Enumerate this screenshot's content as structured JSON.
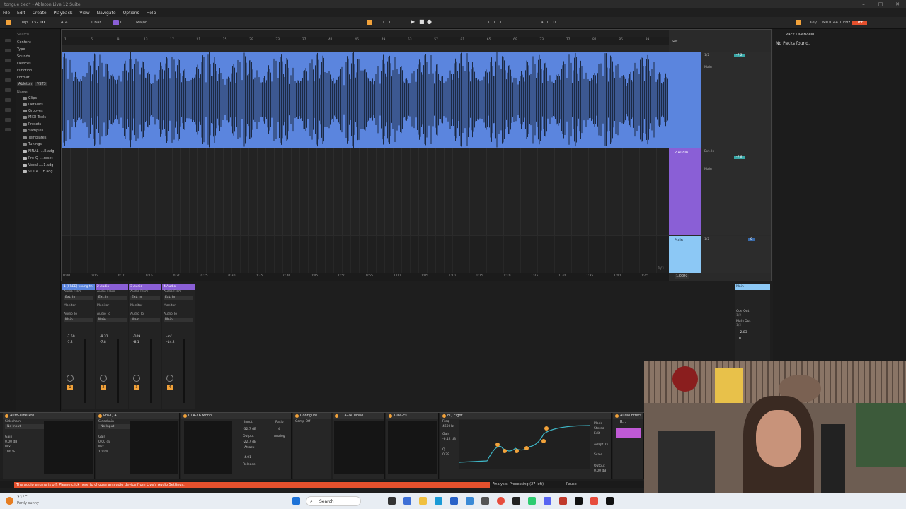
{
  "window": {
    "title": "tongue tied* - Ableton Live 12 Suite"
  },
  "menu": [
    "File",
    "Edit",
    "Create",
    "Playback",
    "View",
    "Navigate",
    "Options",
    "Help"
  ],
  "transport": {
    "tap": "Tap",
    "tempo": "132.00",
    "sig_num": "4",
    "sig_den": "4",
    "quantize": "1 Bar",
    "key": "C",
    "scale": "Major",
    "position": "1 . 1 . 1",
    "loop_start": "3 . 1 . 1",
    "loop_len": "4 . 0 . 0",
    "key_label": "Key",
    "midi_label": "MIDI",
    "sample_rate": "44.1 kHz",
    "cpu": "OFF"
  },
  "browser": {
    "search_placeholder": "Search",
    "filters": [
      "Content",
      "Type",
      "Sounds",
      "Devices",
      "Function",
      "Format"
    ],
    "tags": [
      "Ableton",
      "VST3"
    ],
    "name_header": "Name",
    "items": [
      "Clips",
      "Defaults",
      "Grooves",
      "MIDI Tools",
      "Presets",
      "Samples",
      "Templates",
      "Tunings",
      "FINAL ....E.adg",
      "Pro-Q ....reset",
      "Vocal ....1.adg",
      "VOCA....E.adg"
    ]
  },
  "arrangement": {
    "bars": [
      "1",
      "5",
      "9",
      "13",
      "17",
      "21",
      "25",
      "29",
      "33",
      "37",
      "41",
      "45",
      "49",
      "53",
      "57",
      "61",
      "65",
      "69",
      "73",
      "77",
      "81",
      "85",
      "89"
    ],
    "time": [
      "0:00",
      "0:05",
      "0:10",
      "0:15",
      "0:20",
      "0:25",
      "0:30",
      "0:35",
      "0:40",
      "0:45",
      "0:50",
      "0:55",
      "1:00",
      "1:05",
      "1:10",
      "1:15",
      "1:20",
      "1:25",
      "1:30",
      "1:35",
      "1:40",
      "1:45"
    ],
    "page": "1/1",
    "zoom": "1.00%",
    "set_label": "Set",
    "tracks": [
      {
        "name": "1 Audio",
        "color": "#5b85de",
        "in": "1/2",
        "vol": "-7.2",
        "route": "Main"
      },
      {
        "name": "2 Audio",
        "color": "#8a5fd6",
        "in": "Ext. In",
        "vol": "-7.8",
        "route": "Main"
      },
      {
        "name": "Main",
        "color": "#8cc8f5",
        "in": "1/2",
        "vol": "0",
        "route": ""
      }
    ]
  },
  "mixer": {
    "strips": [
      {
        "name": "1 [FREE] young th",
        "color": "#5b85de",
        "audio_from": "Audio From",
        "from": "Ext. In",
        "monitor": "Monitor",
        "audio_to": "Audio To",
        "to": "Main",
        "vol": "-7.50",
        "pan": "-7.2",
        "num": "1"
      },
      {
        "name": "2 Audio",
        "color": "#8a5fd6",
        "audio_from": "Audio From",
        "from": "Ext. In",
        "monitor": "Monitor",
        "audio_to": "Audio To",
        "to": "Main",
        "vol": "-9.31",
        "pan": "-7.8",
        "num": "2"
      },
      {
        "name": "3 Audio",
        "color": "#8a5fd6",
        "audio_from": "Audio From",
        "from": "Ext. In",
        "monitor": "Monitor",
        "audio_to": "Audio To",
        "to": "Main",
        "vol": "-109",
        "pan": "-8.1",
        "num": "3"
      },
      {
        "name": "4 Audio",
        "color": "#8a5fd6",
        "audio_from": "Audio From",
        "from": "Ext. In",
        "monitor": "Monitor",
        "audio_to": "Audio To",
        "to": "Main",
        "vol": "-inf",
        "pan": "-14.2",
        "num": "4"
      }
    ],
    "main": {
      "name": "Main",
      "cue_out": "Cue Out",
      "cue_val": "1/2",
      "main_out": "Main Out",
      "main_val": "1/2",
      "vol": "-2.83",
      "pan": "0"
    }
  },
  "devices": [
    {
      "name": "Auto-Tune Pro",
      "sidechain": "Sidechain",
      "input": "No Input",
      "gain": "Gain",
      "gain_val": "0.00 dB",
      "mix": "Mix",
      "mix_val": "100 %"
    },
    {
      "name": "Pro-Q 4",
      "sidechain": "Sidechain",
      "input": "No Input",
      "gain": "Gain",
      "gain_val": "0.00 dB",
      "mix": "Mix",
      "mix_val": "100 %"
    },
    {
      "name": "CLA-76 Mono"
    },
    {
      "name": "Configure",
      "input": "Input",
      "input_val": "-32.7 dB",
      "ratio": "Ratio",
      "ratio_val": "4",
      "output": "Output",
      "output_val": "-22.7 dB",
      "attack": "Attack",
      "attack_val": "Analog",
      "release": "Release",
      "release_val": "4.01",
      "comp": "Comp Off",
      "gain": "Gain"
    },
    {
      "name": "CLA-2A Mono"
    },
    {
      "name": "T-De-Es..."
    },
    {
      "name": "EQ Eight",
      "freq": "Freq",
      "freq_val": "460 Hz",
      "gain": "Gain",
      "gain_val": "-6.12 dB",
      "q": "Q",
      "q_val": "0.79",
      "mode": "Mode",
      "mode_val": "Stereo",
      "edit": "Edit",
      "adapt": "Adapt. Q",
      "scale": "Scale",
      "output": "Output",
      "output_val": "0.00 dB"
    },
    {
      "name": "Audio Effect R..."
    }
  ],
  "status": {
    "error": "The audio engine is off. Please click here to choose an audio device from Live's Audio Settings.",
    "analysis": "Analysis: Processing (27 left)",
    "pause": "Pause"
  },
  "right_panel": {
    "title": "Pack Overview",
    "empty": "No Packs found."
  },
  "taskbar": {
    "temperature": "21°C",
    "weather": "Partly sunny",
    "search": "Search"
  },
  "colors": {
    "accent": "#f2a23a",
    "track1": "#5b85de",
    "track2": "#8a5fd6",
    "main": "#8cc8f5",
    "error": "#e4502d"
  }
}
